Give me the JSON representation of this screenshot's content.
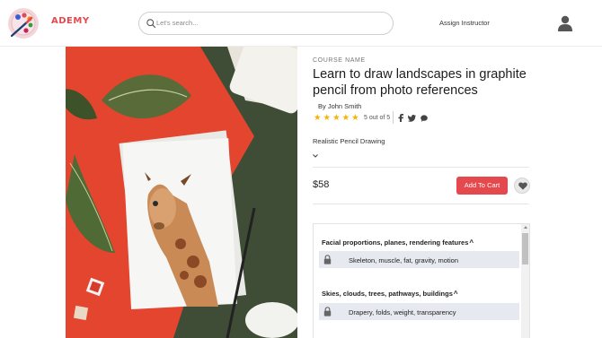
{
  "header": {
    "brand": "ADEMY",
    "search_placeholder": "Let's search...",
    "assign_label": "Assign Instructor"
  },
  "course": {
    "eyebrow": "COURSE NAME",
    "title": "Learn to draw landscapes in graphite pencil from photo references",
    "author": "By John Smith",
    "rating": 5,
    "rating_text": "5 out of 5",
    "subtitle": "Realistic Pencil Drawing",
    "price": "$58",
    "cart_label": "Add To Cart"
  },
  "curriculum": {
    "sections": [
      {
        "title": "Facial proportions, planes, rendering features",
        "caret": "^",
        "lesson": "Skeleton, muscle, fat, gravity, motion"
      },
      {
        "title": "Skies, clouds, trees, pathways, buildings",
        "caret": "^",
        "lesson": "Drapery, folds, weight, transparency"
      }
    ]
  },
  "colors": {
    "accent": "#e5484d",
    "star": "#f5b301",
    "lesson_bg": "#e6e9ef"
  }
}
